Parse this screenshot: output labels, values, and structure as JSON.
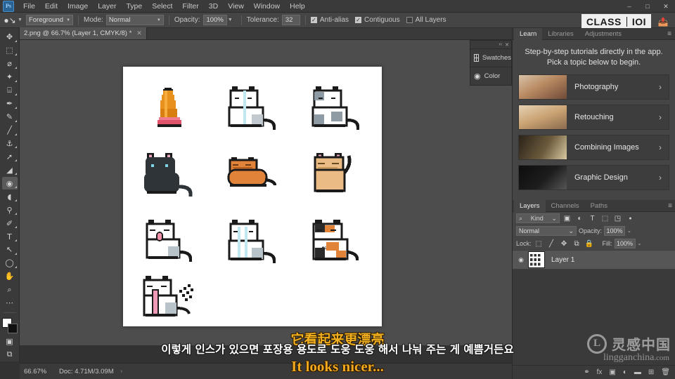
{
  "app": {
    "name": "Adobe Photoshop",
    "logo_glyph": "Ps"
  },
  "menubar": {
    "items": [
      {
        "label": "File"
      },
      {
        "label": "Edit"
      },
      {
        "label": "Image"
      },
      {
        "label": "Layer"
      },
      {
        "label": "Type"
      },
      {
        "label": "Select"
      },
      {
        "label": "Filter"
      },
      {
        "label": "3D"
      },
      {
        "label": "View"
      },
      {
        "label": "Window"
      },
      {
        "label": "Help"
      }
    ]
  },
  "window_controls": {
    "minimize": "–",
    "maximize": "□",
    "close": "✕"
  },
  "options_bar": {
    "tool_icon": "paint-bucket",
    "fill_source": "Foreground",
    "mode_label": "Mode:",
    "mode_value": "Normal",
    "opacity_label": "Opacity:",
    "opacity_value": "100%",
    "tolerance_label": "Tolerance:",
    "tolerance_value": "32",
    "anti_alias_label": "Anti-alias",
    "anti_alias_checked": true,
    "contiguous_label": "Contiguous",
    "contiguous_checked": true,
    "all_layers_label": "All Layers",
    "all_layers_checked": false
  },
  "brand": {
    "logo_left": "CLASS",
    "logo_right": "IOI",
    "share_icon": "share-icon"
  },
  "document_tab": {
    "title": "2.png @ 66.7% (Layer 1, CMYK/8) *",
    "close_glyph": "✕"
  },
  "toolbar": {
    "tools": [
      {
        "name": "move-tool",
        "glyph": "✥"
      },
      {
        "name": "marquee-tool",
        "glyph": "⬚"
      },
      {
        "name": "lasso-tool",
        "glyph": "⌀"
      },
      {
        "name": "quick-selection-tool",
        "glyph": "✦"
      },
      {
        "name": "crop-tool",
        "glyph": "⌸"
      },
      {
        "name": "eyedropper-tool",
        "glyph": "✒"
      },
      {
        "name": "healing-brush-tool",
        "glyph": "✎"
      },
      {
        "name": "brush-tool",
        "glyph": "╱"
      },
      {
        "name": "clone-stamp-tool",
        "glyph": "⚓"
      },
      {
        "name": "history-brush-tool",
        "glyph": "➚"
      },
      {
        "name": "eraser-tool",
        "glyph": "◢"
      },
      {
        "name": "paint-bucket-tool",
        "glyph": "◉",
        "active": true
      },
      {
        "name": "blur-tool",
        "glyph": "◖"
      },
      {
        "name": "dodge-tool",
        "glyph": "⚲"
      },
      {
        "name": "pen-tool",
        "glyph": "✐"
      },
      {
        "name": "type-tool",
        "glyph": "T"
      },
      {
        "name": "path-selection-tool",
        "glyph": "↖"
      },
      {
        "name": "ellipse-tool",
        "glyph": "◯"
      },
      {
        "name": "hand-tool",
        "glyph": "✋"
      },
      {
        "name": "zoom-tool",
        "glyph": "⌕"
      },
      {
        "name": "edit-toolbar-tool",
        "glyph": "⋯"
      }
    ],
    "quickmask_glyph": "▣",
    "screenmode_glyph": "⧉",
    "foreground_color": "#ffffff",
    "background_color": "#111111"
  },
  "mini_panels": {
    "collapse_glyph": "‹‹",
    "close_glyph": "✕",
    "items": [
      {
        "name": "swatches-panel",
        "label": "Swatches",
        "icon": "grid-icon"
      },
      {
        "name": "color-panel",
        "label": "Color",
        "icon": "color-wheel-icon"
      }
    ]
  },
  "learn_panel": {
    "tabs": [
      {
        "label": "Learn",
        "selected": true
      },
      {
        "label": "Libraries",
        "selected": false
      },
      {
        "label": "Adjustments",
        "selected": false
      }
    ],
    "menu_glyph": "≡",
    "intro": "Step-by-step tutorials directly in the app. Pick a topic below to begin.",
    "tutorials": [
      {
        "label": "Photography",
        "chevron": "›",
        "thumb_colors": [
          "#c9a58a",
          "#7e5a48"
        ]
      },
      {
        "label": "Retouching",
        "chevron": "›",
        "thumb_colors": [
          "#dcc3a4",
          "#8a6a4e"
        ]
      },
      {
        "label": "Combining Images",
        "chevron": "›",
        "thumb_colors": [
          "#3a3026",
          "#8d7b5e"
        ]
      },
      {
        "label": "Graphic Design",
        "chevron": "›",
        "thumb_colors": [
          "#1a1a1a",
          "#4a4a4a"
        ]
      }
    ]
  },
  "layers_panel": {
    "tabs": [
      {
        "label": "Layers",
        "selected": true
      },
      {
        "label": "Channels",
        "selected": false
      },
      {
        "label": "Paths",
        "selected": false
      }
    ],
    "menu_glyph": "≡",
    "filter_label": "Kind",
    "filter_icon": "search-icon",
    "filter_chevron": "⌄",
    "filter_type_icons": [
      {
        "name": "filter-pixel-icon",
        "glyph": "▣"
      },
      {
        "name": "filter-adjustment-icon",
        "glyph": "◐"
      },
      {
        "name": "filter-type-icon",
        "glyph": "T"
      },
      {
        "name": "filter-shape-icon",
        "glyph": "⬚"
      },
      {
        "name": "filter-smart-object-icon",
        "glyph": "◳"
      }
    ],
    "filter_toggle_glyph": "●",
    "blend_mode": "Normal",
    "blend_chevron": "⌄",
    "opacity_label": "Opacity:",
    "opacity_value": "100%",
    "opacity_chevron": "⌄",
    "lock_label": "Lock:",
    "lock_icons": [
      {
        "name": "lock-transparent-pixels-icon",
        "glyph": "⬚"
      },
      {
        "name": "lock-image-pixels-icon",
        "glyph": "╱"
      },
      {
        "name": "lock-position-icon",
        "glyph": "✥"
      },
      {
        "name": "lock-artboard-nesting-icon",
        "glyph": "⧉"
      },
      {
        "name": "lock-all-icon",
        "glyph": "🔒"
      }
    ],
    "fill_label": "Fill:",
    "fill_value": "100%",
    "fill_chevron": "⌄",
    "layers": [
      {
        "name": "Layer 1",
        "visible": true,
        "eye_glyph": "◉"
      }
    ],
    "footer_icons": [
      {
        "name": "link-layers-icon",
        "glyph": "⚭"
      },
      {
        "name": "layer-style-icon",
        "glyph": "fx"
      },
      {
        "name": "layer-mask-icon",
        "glyph": "▣"
      },
      {
        "name": "adjustment-layer-icon",
        "glyph": "◐"
      },
      {
        "name": "new-group-icon",
        "glyph": "▬"
      },
      {
        "name": "new-layer-icon",
        "glyph": "⊞"
      },
      {
        "name": "delete-layer-icon",
        "glyph": "🗑"
      }
    ]
  },
  "status_bar": {
    "zoom": "66.67%",
    "doc_label": "Doc: 4.71M/3.09M",
    "arrow_glyph": "›"
  },
  "subtitles": {
    "chinese": "它看起来更漂亮",
    "korean": "이렇게 인스가 있으면 포장용 용도로 도웅 도웅 해서 나눠 주는 게 예쁨거든요",
    "english": "It looks nicer..."
  },
  "watermark": {
    "badge": "L",
    "chinese": "灵感中国",
    "domain": "lingganchina",
    "domain_suffix": ".com"
  },
  "canvas": {
    "document_name": "2.png",
    "zoom_percent": "66.7%",
    "cursor_icon": "paint-bucket-cursor",
    "sprites": [
      {
        "name": "orange-cat-statue-on-pink-bed",
        "row": 1,
        "col": 1
      },
      {
        "name": "white-cat-sitting",
        "row": 1,
        "col": 2
      },
      {
        "name": "grey-white-spotted-cat-sitting",
        "row": 1,
        "col": 3
      },
      {
        "name": "black-cat-sitting",
        "row": 1,
        "col": 4
      },
      {
        "name": "orange-cat-loaf",
        "row": 2,
        "col": 1
      },
      {
        "name": "cream-cat-standing",
        "row": 2,
        "col": 2
      },
      {
        "name": "white-cat-tongue-out",
        "row": 2,
        "col": 3
      },
      {
        "name": "white-cat-blue-stripes",
        "row": 3,
        "col": 1
      },
      {
        "name": "calico-cat-sitting",
        "row": 3,
        "col": 2
      },
      {
        "name": "white-cat-pink-scarf",
        "row": 3,
        "col": 3
      }
    ]
  }
}
